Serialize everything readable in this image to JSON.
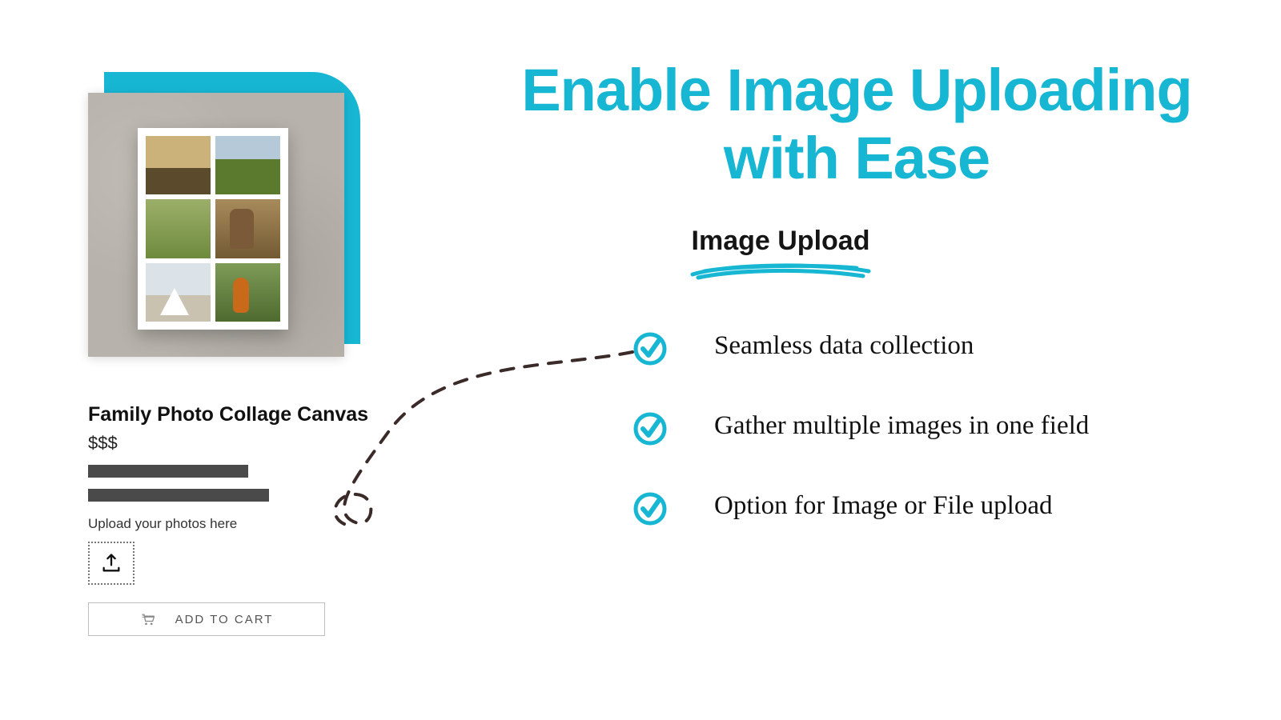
{
  "headline": "Enable Image Uploading with Ease",
  "subhead": "Image Upload",
  "product": {
    "title": "Family Photo Collage Canvas",
    "price": "$$$",
    "upload_label": "Upload your photos here",
    "cta": "ADD TO CART"
  },
  "features": [
    "Seamless data collection",
    "Gather multiple images in one field",
    "Option for Image or File upload"
  ],
  "colors": {
    "accent": "#17b7d4",
    "text": "#111111"
  }
}
